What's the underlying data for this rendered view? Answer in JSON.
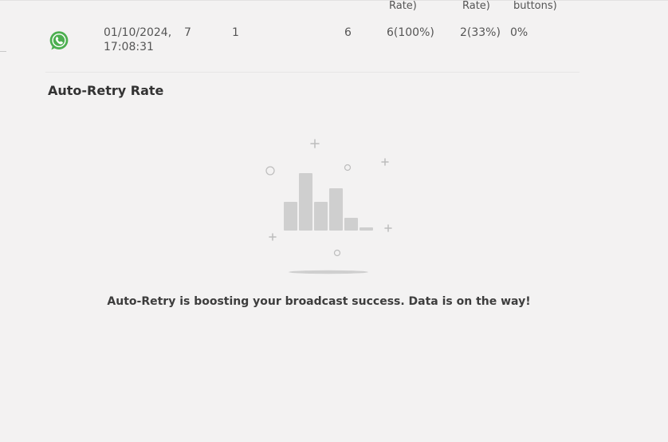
{
  "table": {
    "header_fragments": {
      "col_a": "Rate)",
      "col_b": "Rate)",
      "col_c": "buttons)"
    },
    "row": {
      "channel_icon": "whatsapp-icon",
      "date": "01/10/2024,",
      "time": "17:08:31",
      "v1": "7",
      "v2": "1",
      "v3": "6",
      "v4": "6(100%)",
      "v5": "2(33%)",
      "v6": "0%"
    }
  },
  "section": {
    "title": "Auto-Retry Rate",
    "empty_message": "Auto-Retry is boosting your broadcast success. Data is on the way!"
  },
  "colors": {
    "background": "#f3f2f2",
    "whatsapp_green": "#4caf50",
    "illustration_gray": "#cfcfcf"
  }
}
